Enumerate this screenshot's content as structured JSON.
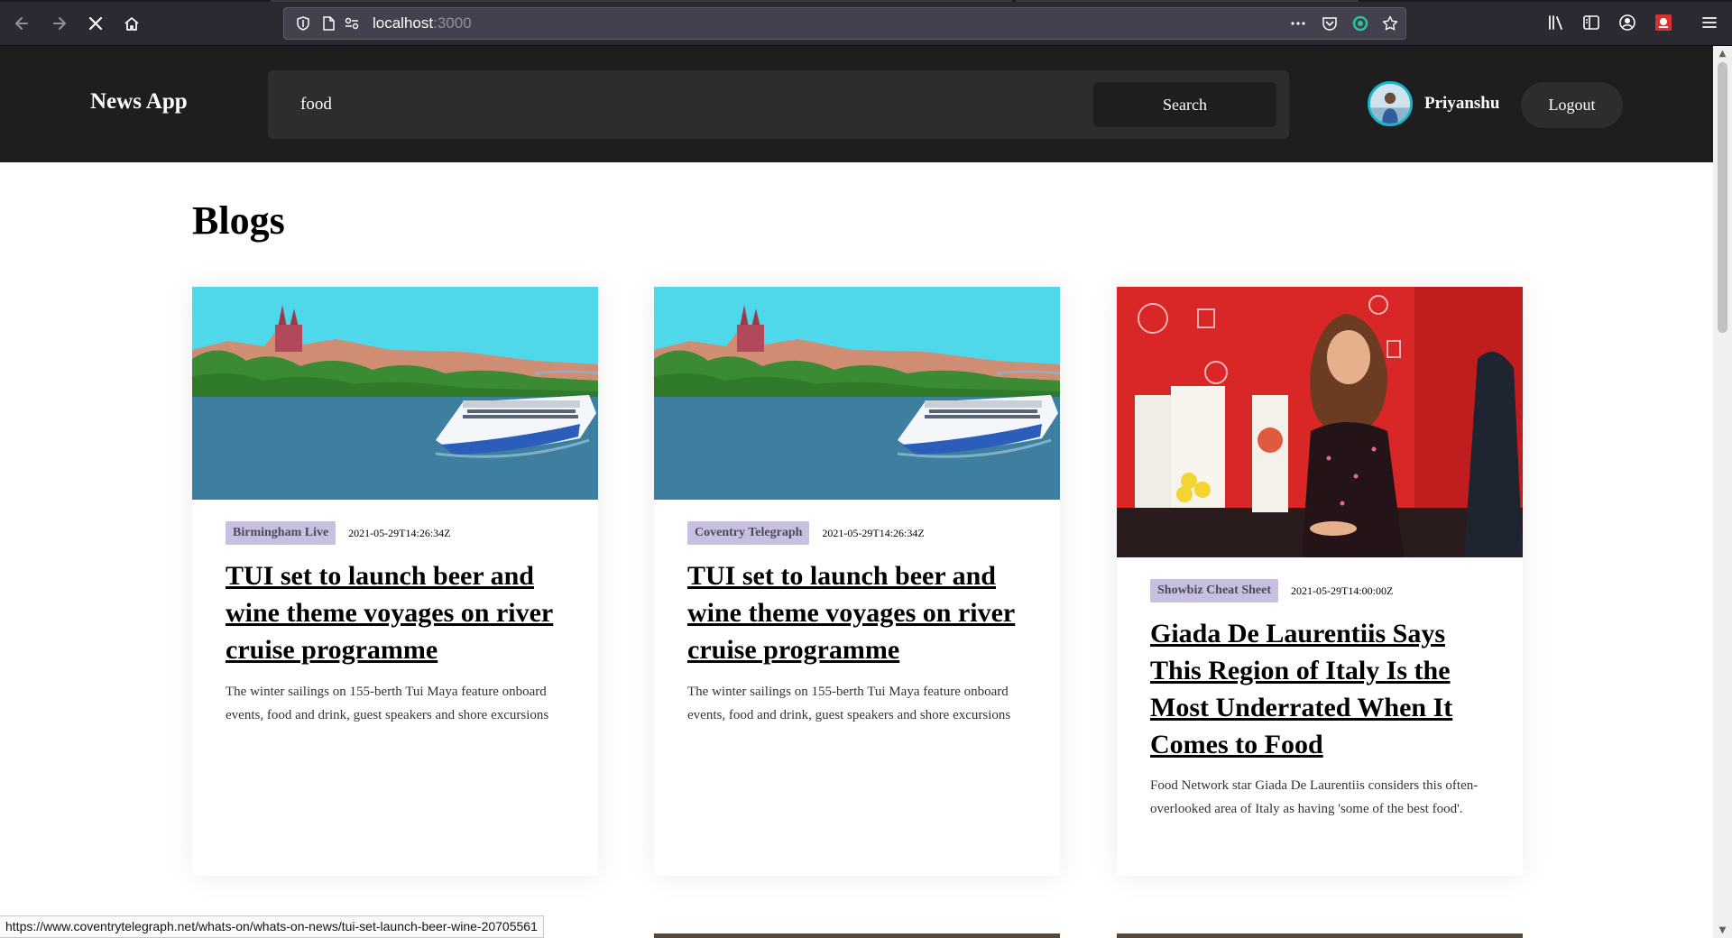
{
  "browser": {
    "url_host": "localhost",
    "url_port": ":3000",
    "status_url": "https://www.coventrytelegraph.net/whats-on/whats-on-news/tui-set-launch-beer-wine-20705561"
  },
  "header": {
    "brand": "News App",
    "search_value": "food",
    "search_button": "Search",
    "username": "Priyanshu",
    "logout_button": "Logout"
  },
  "page": {
    "title": "Blogs",
    "articles": [
      {
        "source": "Birmingham Live",
        "date": "2021-05-29T14:26:34Z",
        "title": "TUI set to launch beer and wine theme voyages on river cruise programme",
        "description": "The winter sailings on 155-berth Tui Maya feature onboard events, food and drink, guest speakers and shore excursions",
        "image": "river-cruise-ship"
      },
      {
        "source": "Coventry Telegraph",
        "date": "2021-05-29T14:26:34Z",
        "title": "TUI set to launch beer and wine theme voyages on river cruise programme",
        "description": "The winter sailings on 155-berth Tui Maya feature onboard events, food and drink, guest speakers and shore excursions",
        "image": "river-cruise-ship"
      },
      {
        "source": "Showbiz Cheat Sheet",
        "date": "2021-05-29T14:00:00Z",
        "title": "Giada De Laurentiis Says This Region of Italy Is the Most Underrated When It Comes to Food",
        "description": "Food Network star Giada De Laurentiis considers this often-overlooked area of Italy as having 'some of the best food'.",
        "image": "chef-portrait"
      }
    ]
  }
}
